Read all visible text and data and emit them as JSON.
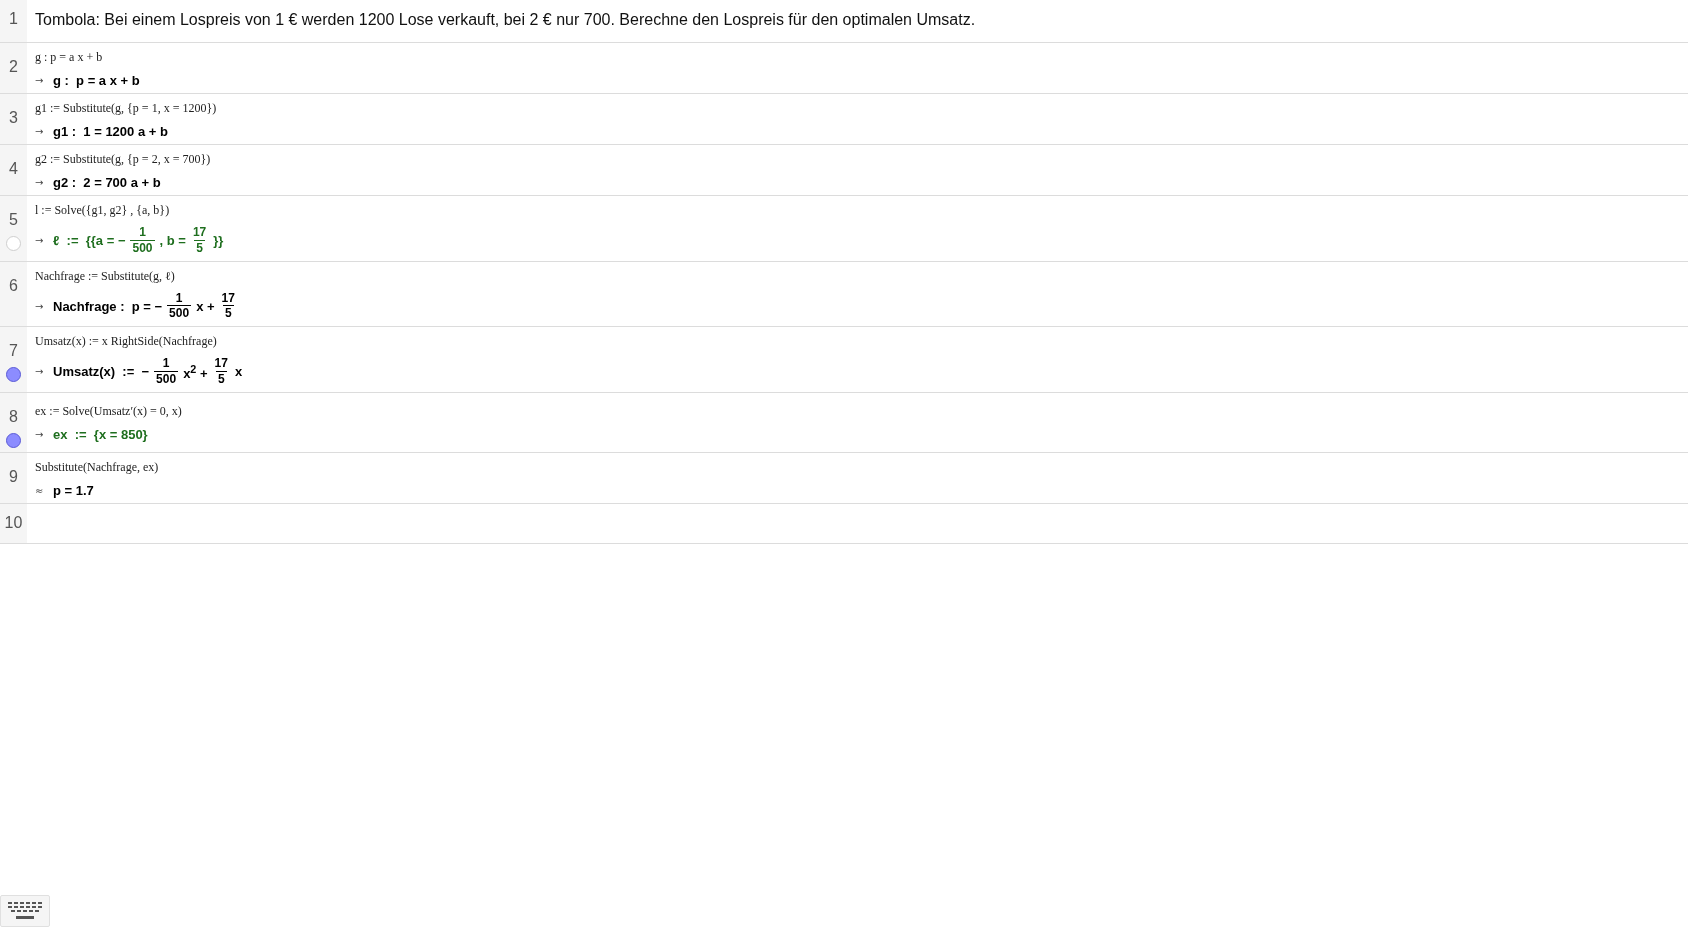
{
  "rows": [
    {
      "number": "1",
      "kind": "text",
      "text": "Tombola: Bei einem Lospreis von 1 € werden 1200 Lose verkauft, bei 2 € nur 700. Berechne den Lospreis für den optimalen Umsatz."
    },
    {
      "number": "2",
      "kind": "cas",
      "input": "g : p = a x + b",
      "prefix": "→",
      "color": "#000000",
      "output": [
        {
          "kind": "text",
          "text": "g :  p = a x + b"
        }
      ]
    },
    {
      "number": "3",
      "kind": "cas",
      "input": "g1 := Substitute(g, {p = 1, x = 1200})",
      "prefix": "→",
      "color": "#000000",
      "output": [
        {
          "kind": "text",
          "text": "g1 :  1 = 1200 a + b"
        }
      ]
    },
    {
      "number": "4",
      "kind": "cas",
      "input": "g2 := Substitute(g, {p = 2, x = 700})",
      "prefix": "→",
      "color": "#000000",
      "output": [
        {
          "kind": "text",
          "text": "g2 :  2 = 700 a + b"
        }
      ]
    },
    {
      "number": "5",
      "kind": "cas",
      "toggle": {
        "on": false
      },
      "input": "l := Solve({g1, g2} , {a, b})",
      "prefix": "→",
      "color": "#1e6e1e",
      "output": [
        {
          "kind": "text",
          "text": "ℓ  :=  {{a = −"
        },
        {
          "kind": "frac",
          "num": "1",
          "den": "500"
        },
        {
          "kind": "text",
          "text": ", b ="
        },
        {
          "kind": "frac",
          "num": "17",
          "den": "5"
        },
        {
          "kind": "text",
          "text": "}}"
        }
      ]
    },
    {
      "number": "6",
      "kind": "cas",
      "input": "Nachfrage := Substitute(g, ℓ)",
      "prefix": "→",
      "color": "#000000",
      "output": [
        {
          "kind": "text",
          "text": "Nachfrage :  p = −"
        },
        {
          "kind": "frac",
          "num": "1",
          "den": "500"
        },
        {
          "kind": "text",
          "text": "x +"
        },
        {
          "kind": "frac",
          "num": "17",
          "den": "5"
        }
      ]
    },
    {
      "number": "7",
      "kind": "cas",
      "toggle": {
        "on": true
      },
      "input": "Umsatz(x) := x RightSide(Nachfrage)",
      "prefix": "→",
      "color": "#000000",
      "output": [
        {
          "kind": "text",
          "text": "Umsatz(x)  :=  −"
        },
        {
          "kind": "frac",
          "num": "1",
          "den": "500"
        },
        {
          "kind": "text",
          "text": "x$^{2}$ +"
        },
        {
          "kind": "frac",
          "num": "17",
          "den": "5"
        },
        {
          "kind": "text",
          "text": "x"
        }
      ]
    },
    {
      "number": "8",
      "kind": "cas",
      "toggle": {
        "on": true
      },
      "input": "ex := Solve(Umsatz′(x) = 0, x)",
      "prefix": "→",
      "color": "#1e6e1e",
      "output": [
        {
          "kind": "text",
          "text": "ex  :=  {x = 850}"
        }
      ]
    },
    {
      "number": "9",
      "kind": "cas",
      "input": "Substitute(Nachfrage, ex)",
      "prefix": "≈",
      "color": "#000000",
      "output": [
        {
          "kind": "text",
          "text": "p = 1.7"
        }
      ]
    },
    {
      "number": "10",
      "kind": "empty"
    }
  ]
}
